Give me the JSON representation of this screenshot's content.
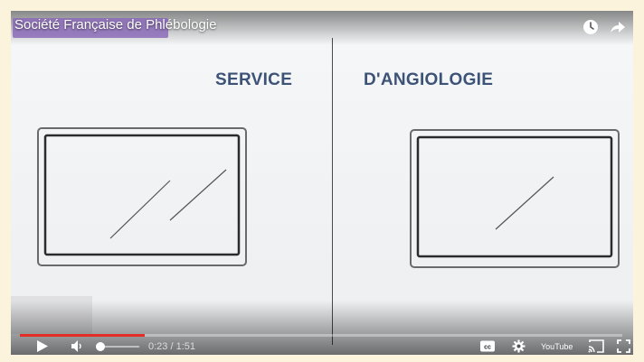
{
  "video": {
    "title": "Société Française de Phlébologie",
    "word_left": "SERVICE",
    "word_right": "D'ANGIOLOGIE"
  },
  "controls": {
    "current_time": "0:23",
    "duration": "1:51",
    "time_display": "0:23 / 1:51",
    "progress_fraction": 0.207,
    "youtube_logo_text": "YouTube",
    "cc_label": "cc"
  },
  "icons": {
    "watch_later": "clock-icon",
    "share": "share-arrow-icon",
    "play": "play-icon",
    "volume": "volume-icon",
    "cc": "captions-icon",
    "settings": "gear-icon",
    "cast": "cast-icon",
    "fullscreen": "fullscreen-icon"
  },
  "colors": {
    "progress": "#e52d27",
    "title_highlight": "#8b6bb8",
    "text_blue": "#3d5277"
  }
}
